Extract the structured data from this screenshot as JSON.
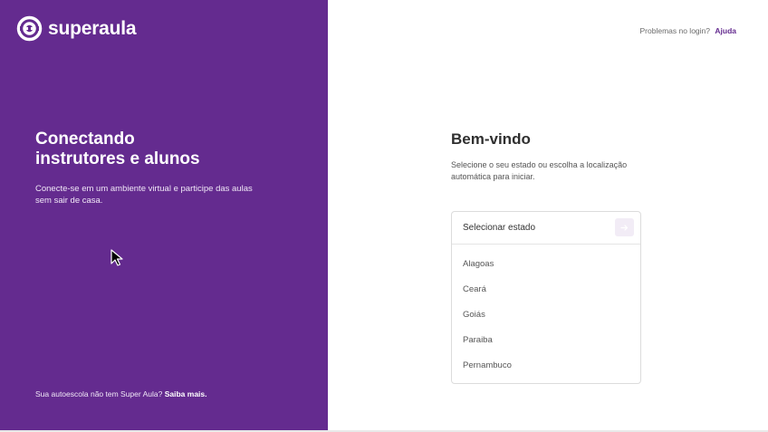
{
  "brand": {
    "name": "superaula"
  },
  "hero": {
    "title_line1": "Conectando",
    "title_line2": "instrutores e alunos",
    "subtitle": "Conecte-se em um ambiente virtual e participe das aulas sem sair de casa."
  },
  "footer": {
    "question": "Sua autoescola não tem Super Aula?",
    "link": "Saiba mais."
  },
  "help": {
    "question": "Problemas no login?",
    "link": "Ajuda"
  },
  "welcome": {
    "title": "Bem-vindo",
    "subtitle": "Selecione o seu estado ou escolha a localização automática para iniciar."
  },
  "state_select": {
    "label": "Selecionar estado",
    "options": [
      "Alagoas",
      "Ceará",
      "Goiás",
      "Paraiba",
      "Pernambuco"
    ]
  },
  "colors": {
    "brand_purple": "#642b8f",
    "button_bg": "#f2ecf6"
  },
  "icons": {
    "logo": "superaula-logo-icon",
    "go": "arrow-right-icon",
    "cursor": "mouse-cursor-icon"
  }
}
